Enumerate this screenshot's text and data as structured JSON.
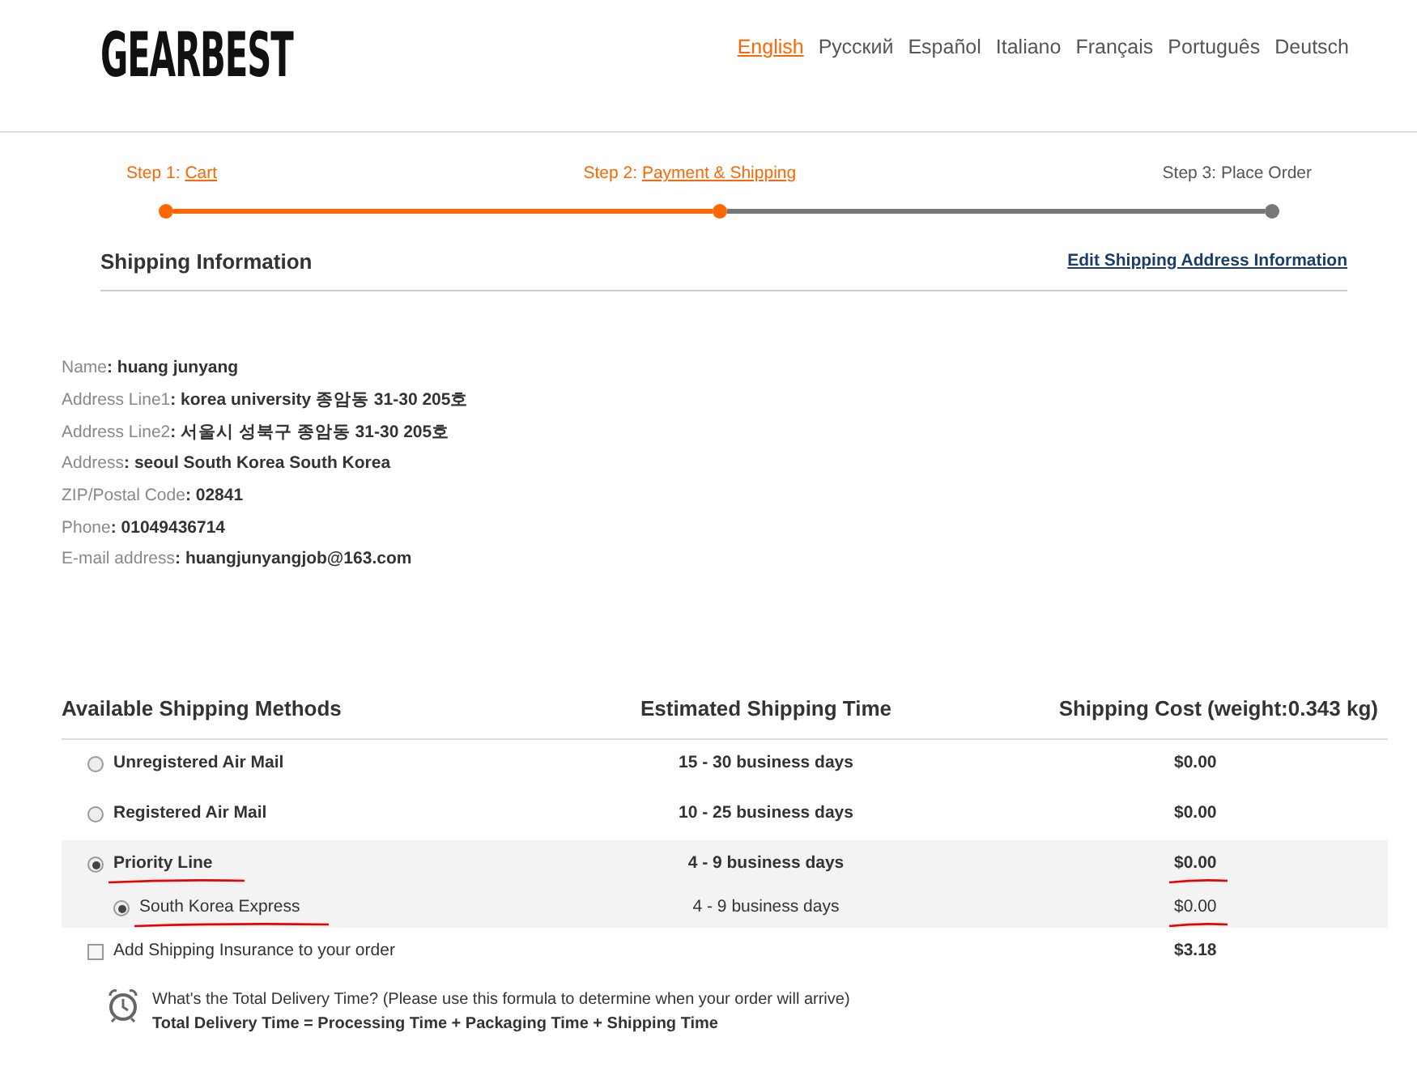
{
  "logo": "GEARBEST",
  "languages": [
    {
      "label": "English",
      "selected": true
    },
    {
      "label": "Русский",
      "selected": false
    },
    {
      "label": "Español",
      "selected": false
    },
    {
      "label": "Italiano",
      "selected": false
    },
    {
      "label": "Français",
      "selected": false
    },
    {
      "label": "Português",
      "selected": false
    },
    {
      "label": "Deutsch",
      "selected": false
    }
  ],
  "steps": [
    {
      "prefix": "Step 1: ",
      "label": "Cart",
      "done": true,
      "link": true
    },
    {
      "prefix": "Step 2: ",
      "label": "Payment & Shipping",
      "done": true,
      "link": true
    },
    {
      "prefix": "Step 3: ",
      "label": "Place Order",
      "done": false,
      "link": false
    }
  ],
  "shipping_info": {
    "title": "Shipping Information",
    "edit_link": "Edit Shipping Address Information"
  },
  "address": [
    "Name**: huang junyang**",
    "Address Line1**: korea university 종암동 31-30 205호**",
    "Address Line2**: 서울시 성북구 종암동 31-30 205호**",
    "Address**: seoul South Korea South Korea**",
    "ZIP/Postal Code**: 02841**",
    "Phone**: 01049436714**",
    "E-mail address**: huangjunyangjob@163.com**"
  ],
  "methods_table": {
    "columns": [
      "Available Shipping Methods",
      "Estimated Shipping Time",
      "Shipping Cost (weight:0.343 kg)"
    ],
    "rows": [
      {
        "name": "Unregistered Air Mail",
        "time": "15 - 30 business days",
        "cost": "$0.00",
        "selected": false,
        "underlined": false,
        "children": []
      },
      {
        "name": "Registered Air Mail",
        "time": "10 - 25 business days",
        "cost": "$0.00",
        "selected": false,
        "underlined": false,
        "children": []
      },
      {
        "name": "Priority Line",
        "time": "4 - 9 business days",
        "cost": "$0.00",
        "selected": true,
        "underlined": true,
        "children": [
          {
            "name": "South Korea Express",
            "time": "4 - 9 business days",
            "cost": "$0.00",
            "selected": true,
            "underlined": true
          }
        ]
      }
    ]
  },
  "insurance": {
    "label": "Add Shipping Insurance to your order",
    "checked": false,
    "cost": "$3.18"
  },
  "delivery_note": {
    "question": "What's the Total Delivery Time? (Please use this formula to determine when your order will arrive)",
    "formula": "Total Delivery Time = Processing Time + Packaging Time + Shipping Time"
  }
}
